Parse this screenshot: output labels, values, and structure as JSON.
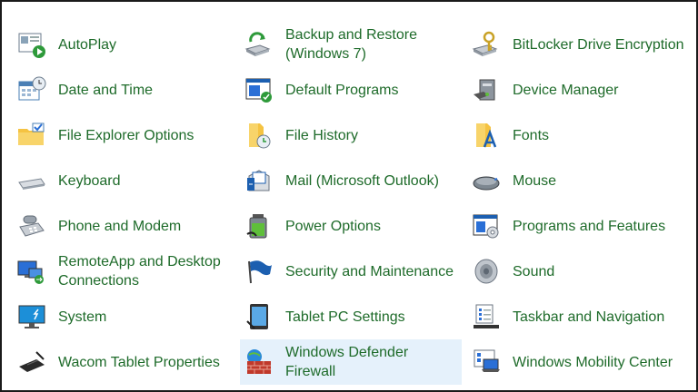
{
  "columns": [
    {
      "items": [
        {
          "label": "AutoPlay",
          "icon": "autoplay-icon"
        },
        {
          "label": "Date and Time",
          "icon": "date-time-icon"
        },
        {
          "label": "File Explorer Options",
          "icon": "folder-options-icon"
        },
        {
          "label": "Keyboard",
          "icon": "keyboard-icon"
        },
        {
          "label": "Phone and Modem",
          "icon": "phone-icon"
        },
        {
          "label": "RemoteApp and Desktop Connections",
          "icon": "remote-desktop-icon"
        },
        {
          "label": "System",
          "icon": "system-icon"
        },
        {
          "label": "Wacom Tablet Properties",
          "icon": "wacom-tablet-icon"
        }
      ]
    },
    {
      "items": [
        {
          "label": "Backup and Restore (Windows 7)",
          "icon": "backup-icon"
        },
        {
          "label": "Default Programs",
          "icon": "default-programs-icon"
        },
        {
          "label": "File History",
          "icon": "file-history-icon"
        },
        {
          "label": "Mail (Microsoft Outlook)",
          "icon": "mail-icon"
        },
        {
          "label": "Power Options",
          "icon": "power-icon"
        },
        {
          "label": "Security and Maintenance",
          "icon": "security-flag-icon"
        },
        {
          "label": "Tablet PC Settings",
          "icon": "tablet-pc-icon"
        },
        {
          "label": "Windows Defender Firewall",
          "icon": "firewall-icon"
        }
      ]
    },
    {
      "items": [
        {
          "label": "BitLocker Drive Encryption",
          "icon": "bitlocker-icon"
        },
        {
          "label": "Device Manager",
          "icon": "device-manager-icon"
        },
        {
          "label": "Fonts",
          "icon": "fonts-icon"
        },
        {
          "label": "Mouse",
          "icon": "mouse-icon"
        },
        {
          "label": "Programs and Features",
          "icon": "programs-features-icon"
        },
        {
          "label": "Sound",
          "icon": "sound-icon"
        },
        {
          "label": "Taskbar and Navigation",
          "icon": "taskbar-icon"
        },
        {
          "label": "Windows Mobility Center",
          "icon": "mobility-center-icon"
        }
      ]
    }
  ],
  "colors": {
    "link": "#1e6b2a",
    "hover_bg": "#e5f1fb"
  }
}
